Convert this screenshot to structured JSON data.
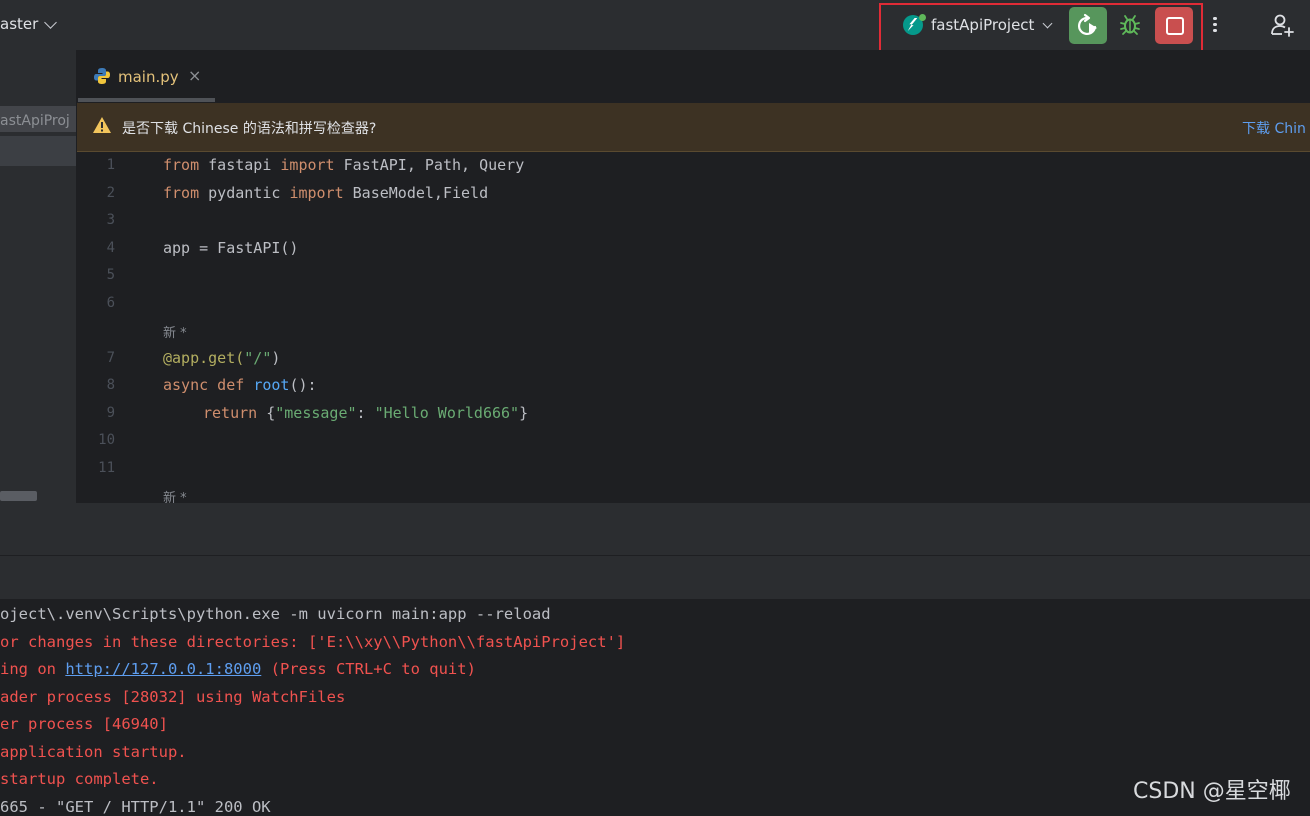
{
  "toolbar": {
    "branch": "aster",
    "run_config": "fastApiProject",
    "icons": [
      "rerun-icon",
      "debug-icon",
      "stop-icon",
      "more-icon",
      "add-user-icon"
    ]
  },
  "project_panel": {
    "label": "astApiProj"
  },
  "tabs": [
    {
      "label": "main.py",
      "close": "×"
    }
  ],
  "notification": {
    "text": "是否下载 Chinese 的语法和拼写检查器?",
    "link": "下载 Chin"
  },
  "editor": {
    "line_numbers": [
      "1",
      "2",
      "3",
      "4",
      "5",
      "6",
      "7",
      "8",
      "9",
      "10",
      "11"
    ],
    "hint": "新 *",
    "code": {
      "l1_kw1": "from",
      "l1_mod": " fastapi ",
      "l1_kw2": "import",
      "l1_rest": " FastAPI, Path, Query",
      "l2_kw1": "from",
      "l2_mod": " pydantic ",
      "l2_kw2": "import",
      "l2_rest": " BaseModel,Field",
      "l4": "app = FastAPI()",
      "l7_deco": "@app.get(",
      "l7_str": "\"/\"",
      "l7_end": ")",
      "l8_kw1": "async",
      "l8_kw2": " def ",
      "l8_fn": "root",
      "l8_end": "():",
      "l9_kw": "return",
      "l9_open": " {",
      "l9_key": "\"message\"",
      "l9_colon": ": ",
      "l9_val": "\"Hello World666\"",
      "l9_close": "}"
    }
  },
  "console": {
    "lines": [
      "oject\\.venv\\Scripts\\python.exe -m uvicorn main:app --reload",
      "or changes in these directories: ['E:\\\\xy\\\\Python\\\\fastApiProject']",
      "ing on ",
      "http://127.0.0.1:8000",
      " (Press CTRL+C to quit)",
      "ader process [28032] using WatchFiles",
      "er process [46940]",
      "application startup.",
      "startup complete.",
      "665 - \"GET / HTTP/1.1\" 200 OK"
    ]
  },
  "watermark": "CSDN @星空椰"
}
